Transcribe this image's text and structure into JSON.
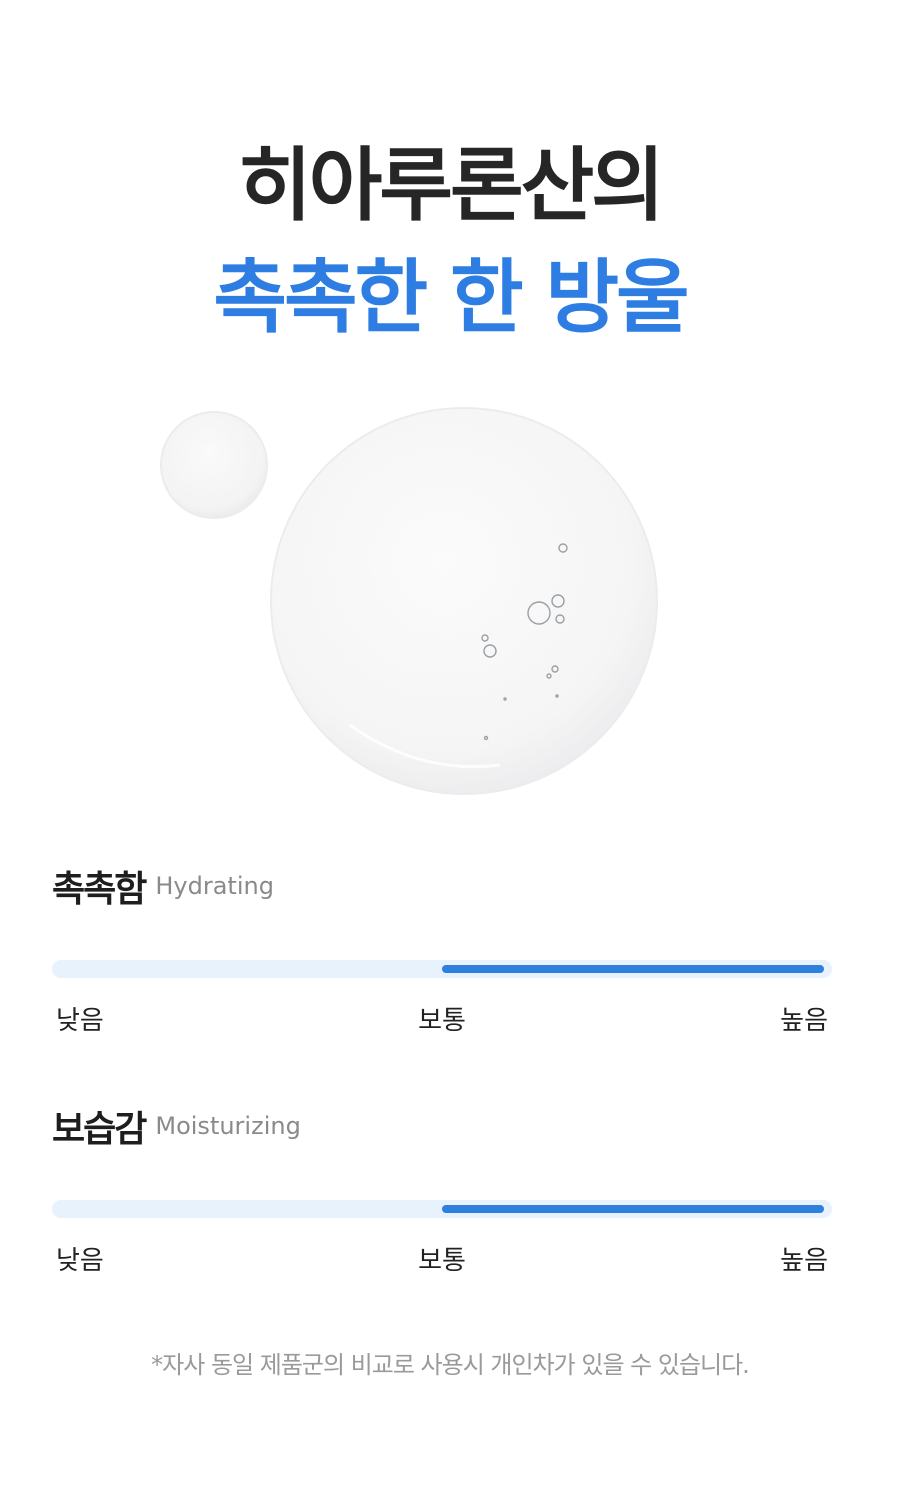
{
  "headline": {
    "line1": "히아루론산의",
    "line2": "촉촉한 한 방울"
  },
  "image": {
    "icon": "hyaluronic-serum-droplets"
  },
  "metrics": [
    {
      "title_ko": "촉촉함",
      "title_en": "Hydrating",
      "level": 1.0,
      "scale": {
        "low": "낮음",
        "mid": "보통",
        "high": "높음"
      }
    },
    {
      "title_ko": "보습감",
      "title_en": "Moisturizing",
      "level": 1.0,
      "scale": {
        "low": "낮음",
        "mid": "보통",
        "high": "높음"
      }
    }
  ],
  "footnote": "*자사 동일 제품군의 비교로 사용시 개인차가 있을 수 있습니다.",
  "colors": {
    "accent": "#2d7de2",
    "track": "#e8f2fc",
    "headline": "#262626"
  }
}
